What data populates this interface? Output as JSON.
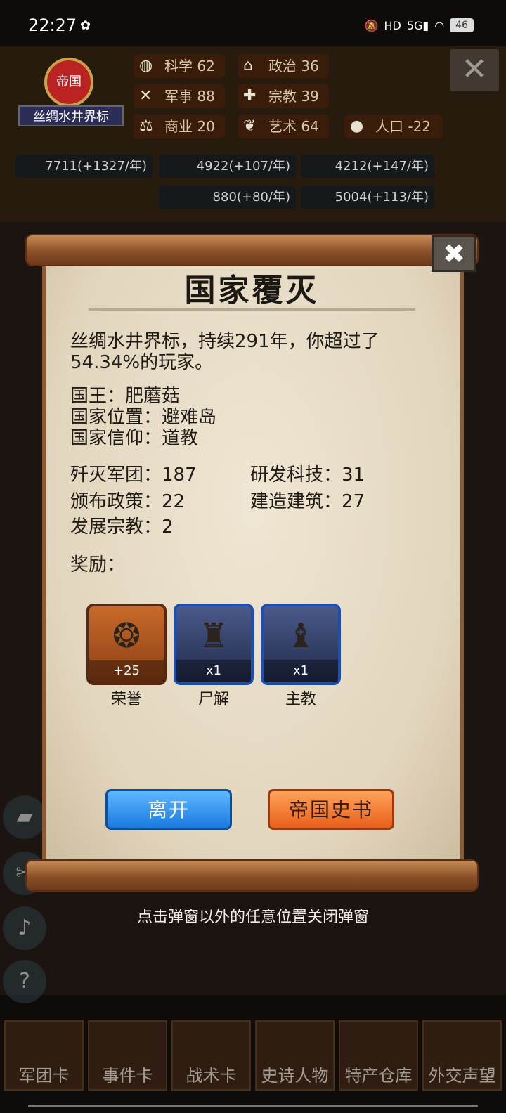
{
  "status_bar": {
    "time": "22:27",
    "battery": "46"
  },
  "hud": {
    "emblem_title": "帝国",
    "nation_name": "丝绸水井界标",
    "stats": [
      {
        "label": "科学",
        "value": "62"
      },
      {
        "label": "政治",
        "value": "36"
      },
      {
        "label": "军事",
        "value": "88"
      },
      {
        "label": "宗教",
        "value": "39"
      },
      {
        "label": "商业",
        "value": "20"
      },
      {
        "label": "艺术",
        "value": "64"
      },
      {
        "label": "人口",
        "value": "-22"
      }
    ],
    "resources": [
      "7711(+1327/年)",
      "4922(+107/年)",
      "4212(+147/年)",
      "880(+80/年)",
      "5004(+113/年)"
    ]
  },
  "dialog": {
    "title": "国家覆灭",
    "summary_line1": "丝绸水井界标，持续291年，你超过了",
    "summary_line2": "54.34%的玩家。",
    "king": "国王：肥蘑菇",
    "location": "国家位置：避难岛",
    "faith": "国家信仰：道教",
    "stats": {
      "destroyed": "歼灭军团：187",
      "research": "研发科技：31",
      "policies": "颁布政策：22",
      "buildings": "建造建筑：27",
      "religions": "发展宗教：2"
    },
    "reward_label": "奖励：",
    "rewards": [
      {
        "name": "荣誉",
        "count": "+25",
        "icon": "medal-icon"
      },
      {
        "name": "尸解",
        "count": "x1",
        "icon": "statue-icon"
      },
      {
        "name": "主教",
        "count": "x1",
        "icon": "bishop-icon"
      }
    ],
    "leave_label": "离开",
    "history_label": "帝国史书"
  },
  "hint": "点击弹窗以外的任意位置关闭弹窗",
  "bottom_nav": [
    "军团卡",
    "事件卡",
    "战术卡",
    "史诗人物",
    "特产仓库",
    "外交声望"
  ]
}
